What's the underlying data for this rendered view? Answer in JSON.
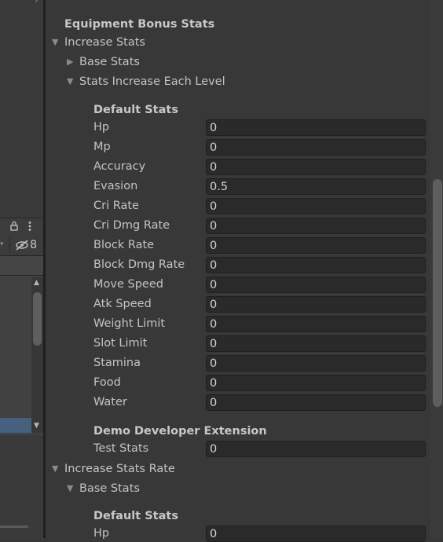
{
  "left_panel": {
    "visibility_count": "8"
  },
  "inspector": {
    "title": "Equipment Bonus Stats",
    "increase_stats": {
      "label": "Increase Stats",
      "base_stats_label": "Base Stats",
      "each_level_label": "Stats Increase Each Level",
      "default_stats_header": "Default Stats",
      "rows": [
        {
          "label": "Hp",
          "value": "0"
        },
        {
          "label": "Mp",
          "value": "0"
        },
        {
          "label": "Accuracy",
          "value": "0"
        },
        {
          "label": "Evasion",
          "value": "0.5"
        },
        {
          "label": "Cri Rate",
          "value": "0"
        },
        {
          "label": "Cri Dmg Rate",
          "value": "0"
        },
        {
          "label": "Block Rate",
          "value": "0"
        },
        {
          "label": "Block Dmg Rate",
          "value": "0"
        },
        {
          "label": "Move Speed",
          "value": "0"
        },
        {
          "label": "Atk Speed",
          "value": "0"
        },
        {
          "label": "Weight Limit",
          "value": "0"
        },
        {
          "label": "Slot Limit",
          "value": "0"
        },
        {
          "label": "Stamina",
          "value": "0"
        },
        {
          "label": "Food",
          "value": "0"
        },
        {
          "label": "Water",
          "value": "0"
        }
      ],
      "extension_header": "Demo Developer Extension",
      "extension_rows": [
        {
          "label": "Test Stats",
          "value": "0"
        }
      ]
    },
    "increase_stats_rate": {
      "label": "Increase Stats Rate",
      "base_stats_label": "Base Stats",
      "default_stats_header": "Default Stats",
      "rows": [
        {
          "label": "Hp",
          "value": "0"
        }
      ]
    }
  },
  "icons": {
    "collapsed": "▶",
    "expanded": "▼",
    "lock": "lock-icon",
    "menu": "kebab-menu-icon",
    "visibility": "eye-slash-icon"
  }
}
